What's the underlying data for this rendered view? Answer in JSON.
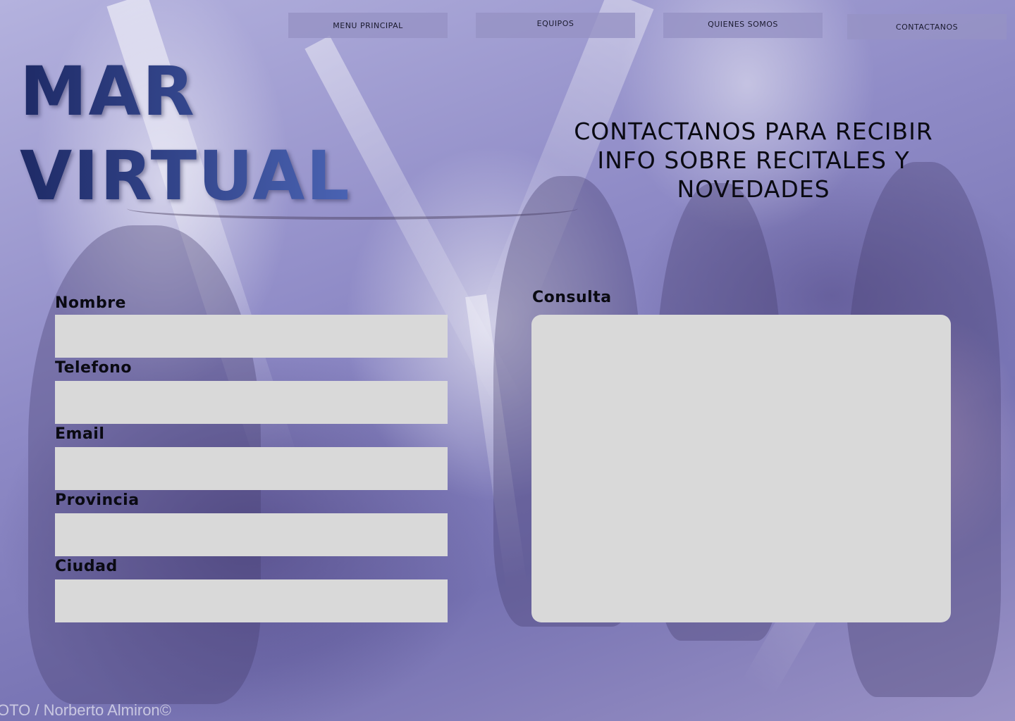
{
  "nav": {
    "items": [
      {
        "label": "MENU PRINCIPAL"
      },
      {
        "label": "EQUIPOS"
      },
      {
        "label": "QUIENES SOMOS"
      },
      {
        "label": "CONTACTANOS"
      }
    ]
  },
  "logo": {
    "line1": "MAR",
    "line2": "VIRTUAL"
  },
  "headline": "CONTACTANOS PARA RECIBIR INFO SOBRE RECITALES Y NOVEDADES",
  "form": {
    "fields": [
      {
        "label": "Nombre",
        "value": ""
      },
      {
        "label": "Telefono",
        "value": ""
      },
      {
        "label": "Email",
        "value": ""
      },
      {
        "label": "Provincia",
        "value": ""
      },
      {
        "label": "Ciudad",
        "value": ""
      }
    ],
    "consulta": {
      "label": "Consulta",
      "value": ""
    }
  },
  "background": {
    "photo_credit": "OTO / Norberto Almiron©"
  },
  "colors": {
    "nav_button": "#9692c4",
    "input_fill": "#d9d9d9",
    "logo_dark": "#1e2a66",
    "logo_light": "#4a63b3"
  }
}
